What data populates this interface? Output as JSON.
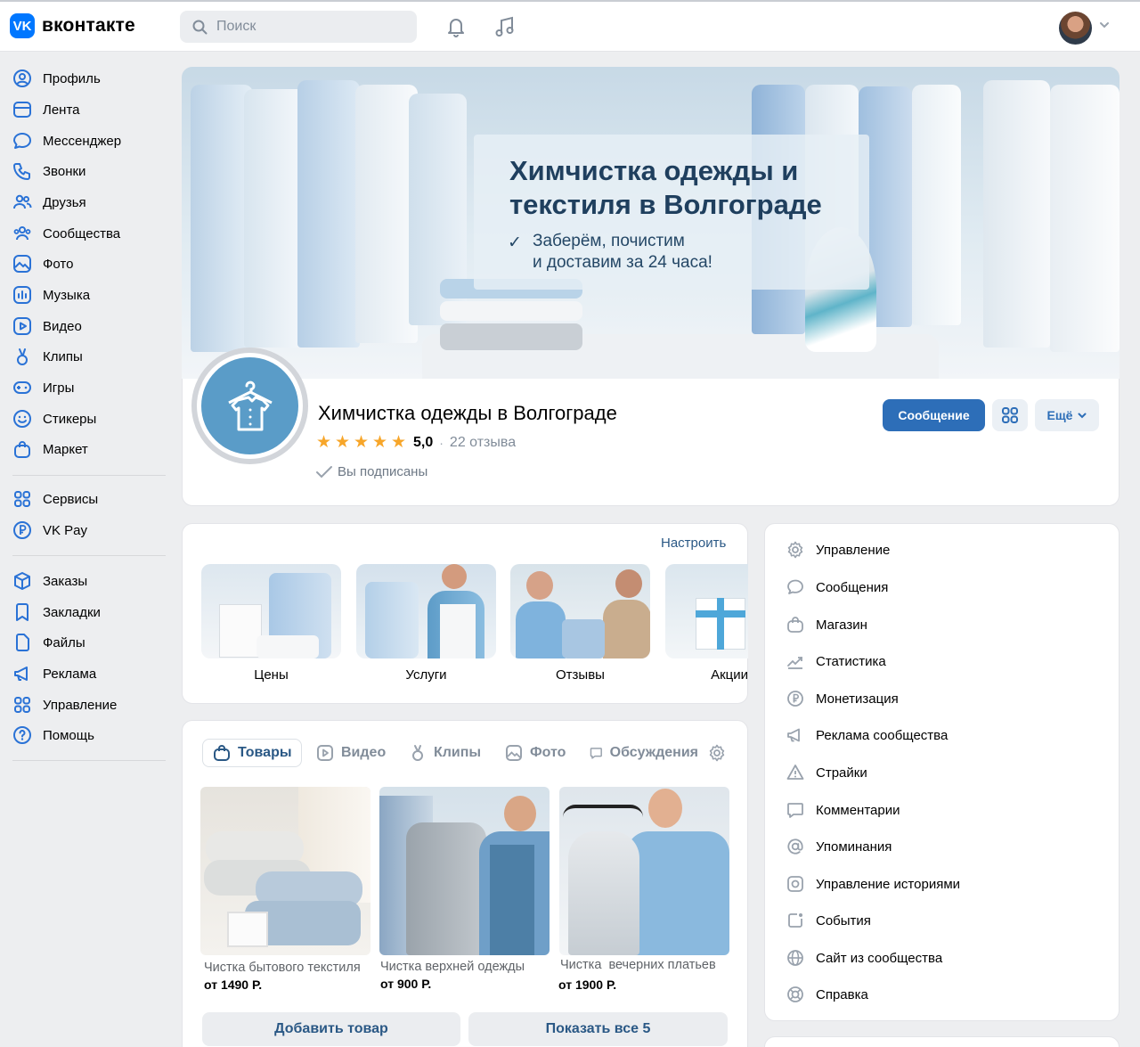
{
  "app": {
    "logo_letter": "VK",
    "logo_text": "вконтакте"
  },
  "header": {
    "search_placeholder": "Поиск"
  },
  "sidebar": {
    "items": [
      {
        "label": "Профиль",
        "icon": "profile-icon"
      },
      {
        "label": "Лента",
        "icon": "feed-icon"
      },
      {
        "label": "Мессенджер",
        "icon": "messenger-icon"
      },
      {
        "label": "Звонки",
        "icon": "phone-icon"
      },
      {
        "label": "Друзья",
        "icon": "friends-icon"
      },
      {
        "label": "Сообщества",
        "icon": "communities-icon"
      },
      {
        "label": "Фото",
        "icon": "photo-icon"
      },
      {
        "label": "Музыка",
        "icon": "music-icon"
      },
      {
        "label": "Видео",
        "icon": "video-icon"
      },
      {
        "label": "Клипы",
        "icon": "clips-icon"
      },
      {
        "label": "Игры",
        "icon": "games-icon"
      },
      {
        "label": "Стикеры",
        "icon": "stickers-icon"
      },
      {
        "label": "Маркет",
        "icon": "market-icon"
      },
      {
        "label": "Сервисы",
        "icon": "services-icon"
      },
      {
        "label": "VK Pay",
        "icon": "vkpay-icon"
      },
      {
        "label": "Заказы",
        "icon": "orders-icon"
      },
      {
        "label": "Закладки",
        "icon": "bookmarks-icon"
      },
      {
        "label": "Файлы",
        "icon": "files-icon"
      },
      {
        "label": "Реклама",
        "icon": "ads-icon"
      },
      {
        "label": "Управление",
        "icon": "manage-icon"
      },
      {
        "label": "Помощь",
        "icon": "help-icon"
      }
    ]
  },
  "cover": {
    "title": "Химчистка одежды и текстиля в Волгограде",
    "subtitle_line1": "Заберём, почистим",
    "subtitle_line2": "и доставим за 24 часа!"
  },
  "group": {
    "name": "Химчистка одежды в Волгограде",
    "rating": "5,0",
    "reviews": "22 отзыва",
    "subscribed": "Вы подписаны",
    "btn_message": "Сообщение",
    "btn_more": "Ещё"
  },
  "menu": {
    "settings": "Настроить",
    "items": [
      "Цены",
      "Услуги",
      "Отзывы",
      "Акции"
    ]
  },
  "tabs": {
    "items": [
      "Товары",
      "Видео",
      "Клипы",
      "Фото",
      "Обсуждения"
    ]
  },
  "products": {
    "items": [
      {
        "name": "Чистка бытового текстиля",
        "price": "от 1490 Р."
      },
      {
        "name": "Чистка верхней одежды",
        "price": "от 900 Р."
      },
      {
        "name": "Чистка  вечерних платьев",
        "price": "от 1900 Р."
      }
    ],
    "add_button": "Добавить товар",
    "show_all_button": "Показать все 5"
  },
  "right_menu": {
    "items": [
      {
        "label": "Управление",
        "icon": "gear-icon"
      },
      {
        "label": "Сообщения",
        "icon": "message-icon"
      },
      {
        "label": "Магазин",
        "icon": "shop-bag-icon"
      },
      {
        "label": "Статистика",
        "icon": "stats-icon"
      },
      {
        "label": "Монетизация",
        "icon": "ruble-icon"
      },
      {
        "label": "Реклама сообщества",
        "icon": "megaphone-icon"
      },
      {
        "label": "Страйки",
        "icon": "warning-icon"
      },
      {
        "label": "Комментарии",
        "icon": "comment-icon"
      },
      {
        "label": "Упоминания",
        "icon": "at-icon"
      },
      {
        "label": "Управление историями",
        "icon": "stories-icon"
      },
      {
        "label": "События",
        "icon": "events-icon"
      },
      {
        "label": "Сайт из сообщества",
        "icon": "globe-icon"
      },
      {
        "label": "Справка",
        "icon": "lifebuoy-icon"
      }
    ]
  },
  "colors": {
    "accent": "#2d6eb8",
    "brand": "#0077ff",
    "star": "#f7a62a"
  }
}
